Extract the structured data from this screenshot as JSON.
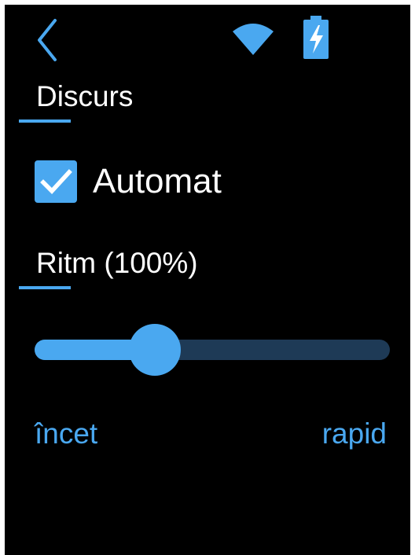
{
  "status_bar": {
    "back_icon": "chevron-left-icon",
    "wifi_icon": "wifi-icon",
    "battery_icon": "battery-charging-icon"
  },
  "speech": {
    "title": "Discurs"
  },
  "auto": {
    "label": "Automat",
    "checked": true
  },
  "rate": {
    "title": "Ritm (100%)",
    "value_percent": 100,
    "slider_fraction": 0.31,
    "min_label": "încet",
    "max_label": "rapid"
  },
  "colors": {
    "accent": "#4aa8f0",
    "track": "#1e3a56",
    "background": "#000000",
    "text": "#ffffff"
  }
}
